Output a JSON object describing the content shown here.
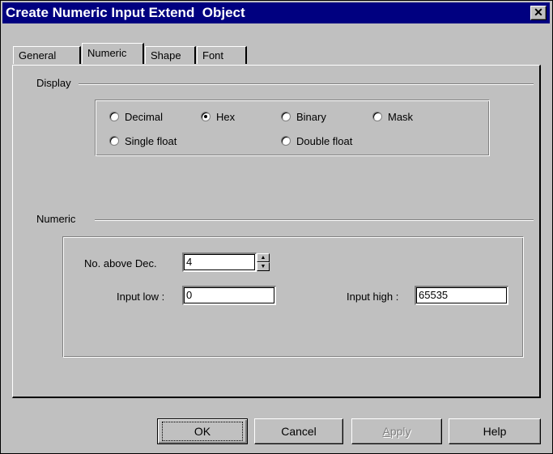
{
  "window": {
    "title": "Create Numeric Input Extend  Object"
  },
  "tabs": [
    {
      "label": "General"
    },
    {
      "label": "Numeric"
    },
    {
      "label": "Shape"
    },
    {
      "label": "Font"
    }
  ],
  "display": {
    "group_label": "Display",
    "options": [
      {
        "label": "Decimal",
        "checked": false
      },
      {
        "label": "Hex",
        "checked": true
      },
      {
        "label": "Binary",
        "checked": false
      },
      {
        "label": "Mask",
        "checked": false
      },
      {
        "label": "Single float",
        "checked": false
      },
      {
        "label": "Double float",
        "checked": false
      }
    ]
  },
  "numeric": {
    "group_label": "Numeric",
    "above_dec_label": "No. above Dec.",
    "above_dec_value": "4",
    "input_low_label": "Input low :",
    "input_low_value": "0",
    "input_high_label": "Input high :",
    "input_high_value": "65535"
  },
  "buttons": {
    "ok": "OK",
    "cancel": "Cancel",
    "apply": "Apply",
    "help": "Help"
  }
}
